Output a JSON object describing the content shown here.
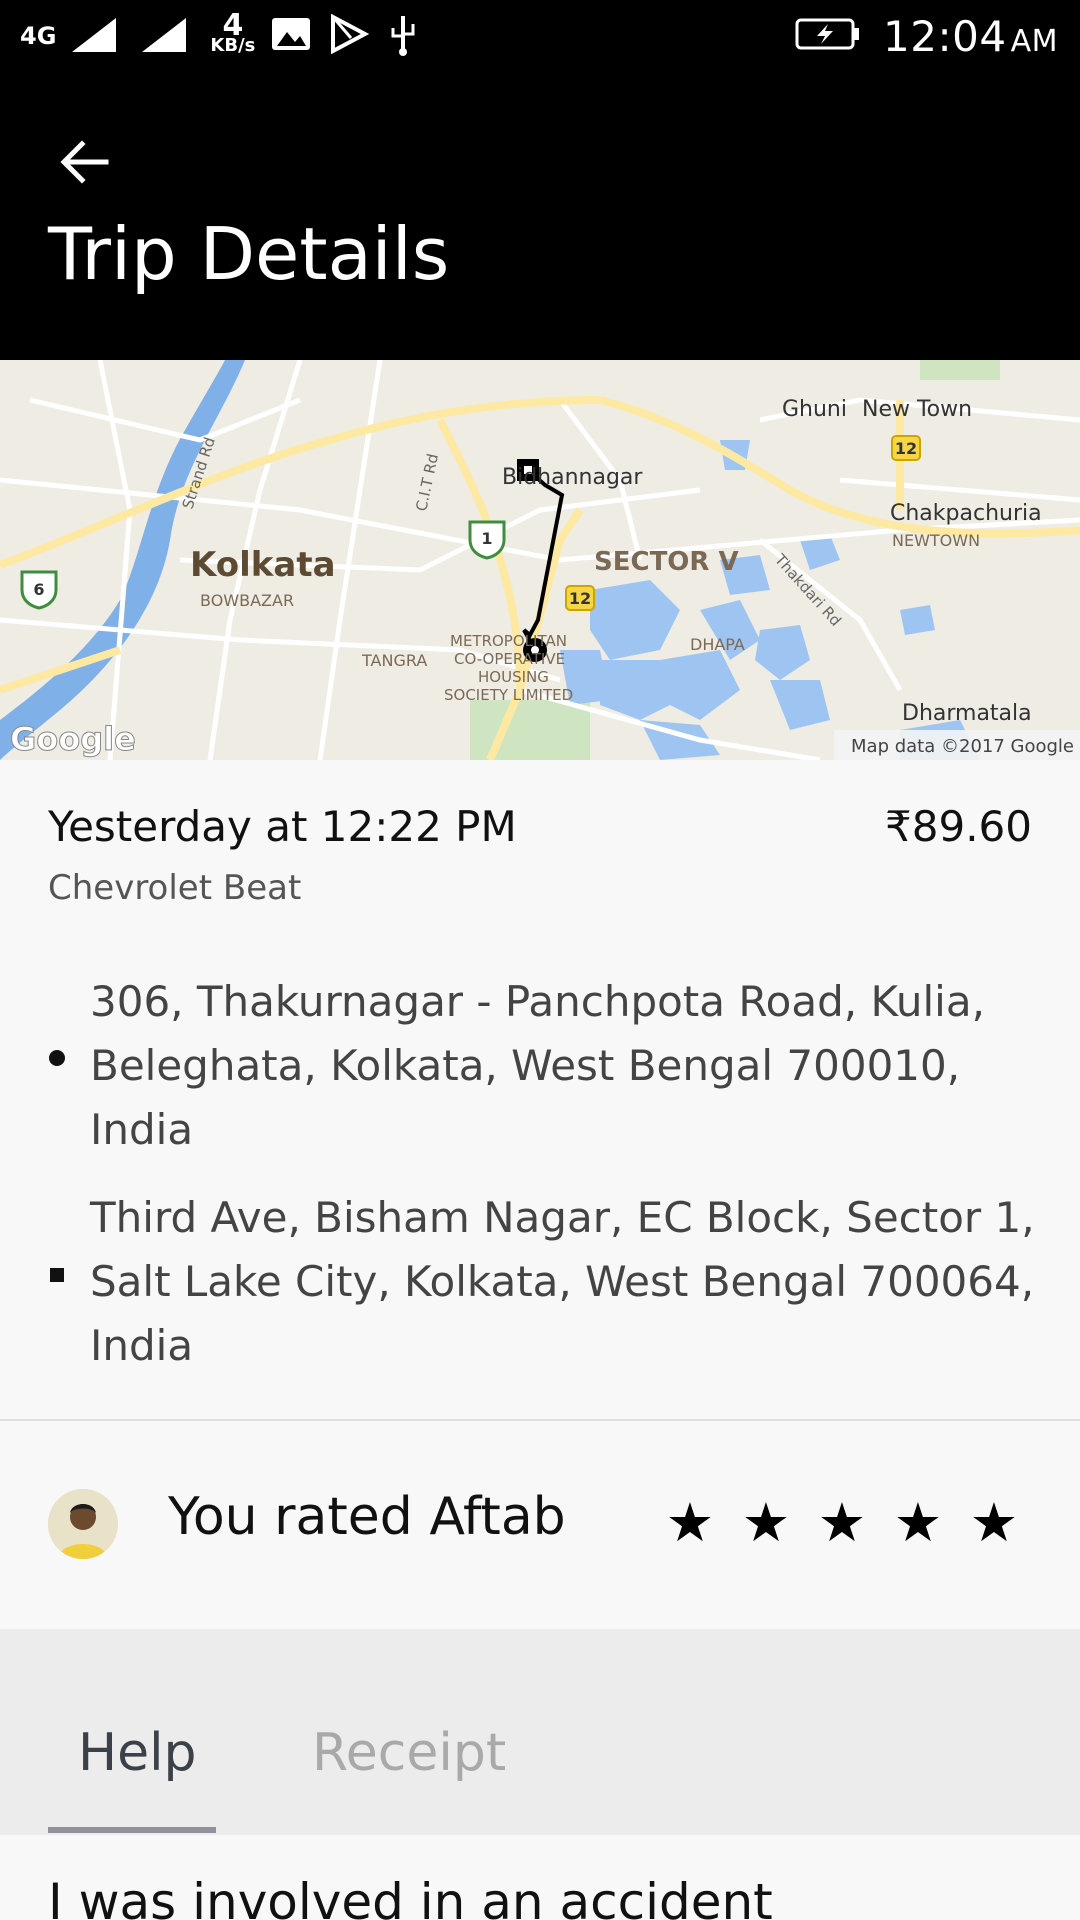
{
  "status_bar": {
    "network": "4G",
    "data_rate_value": "4",
    "data_rate_unit": "KB/s",
    "time": "12:04",
    "ampm": "AM"
  },
  "header": {
    "title": "Trip Details"
  },
  "map": {
    "labels": {
      "kolkata": "Kolkata",
      "bowbazar": "BOWBAZAR",
      "tangra": "TANGRA",
      "bidhannagar": "Bidhannagar",
      "sector_v": "SECTOR V",
      "dhapa": "DHAPA",
      "ghuni": "Ghuni",
      "new_town": "New Town",
      "chakpachuria": "Chakpachuria",
      "newtown": "NEWTOWN",
      "dharmatala": "Dharmatala",
      "metro_1": "METROPOLITAN",
      "metro_2": "CO-OPERATIVE",
      "metro_3": "HOUSING",
      "metro_4": "SOCIETY LIMITED",
      "strand_rd": "Strand Rd",
      "cit_rd": "C.I.T Rd",
      "thakdari_rd": "Thakdari Rd",
      "shield_6": "6",
      "shield_1": "1",
      "shield_12a": "12",
      "shield_12b": "12",
      "google": "Google",
      "attribution": "Map data ©2017 Google"
    },
    "colors": {
      "land": "#efece4",
      "water": "#9ec4f2",
      "river": "#7fb0e8",
      "road": "#ffffff",
      "major_road": "#fde9a2",
      "park": "#cfe4c0"
    }
  },
  "trip": {
    "when": "Yesterday at 12:22 PM",
    "fare": "₹89.60",
    "car": "Chevrolet Beat",
    "pickup": "306, Thakurnagar - Panchpota Road, Kulia, Beleghata, Kolkata, West Bengal 700010, India",
    "dropoff": "Third Ave, Bisham Nagar, EC Block, Sector 1, Salt Lake City, Kolkata, West Bengal 700064, India"
  },
  "rating": {
    "text": "You rated Aftab",
    "stars": 5,
    "star_glyphs": [
      "★",
      "★",
      "★",
      "★",
      "★"
    ]
  },
  "tabs": {
    "help": "Help",
    "receipt": "Receipt"
  },
  "help_items": [
    "I was involved in an accident"
  ]
}
